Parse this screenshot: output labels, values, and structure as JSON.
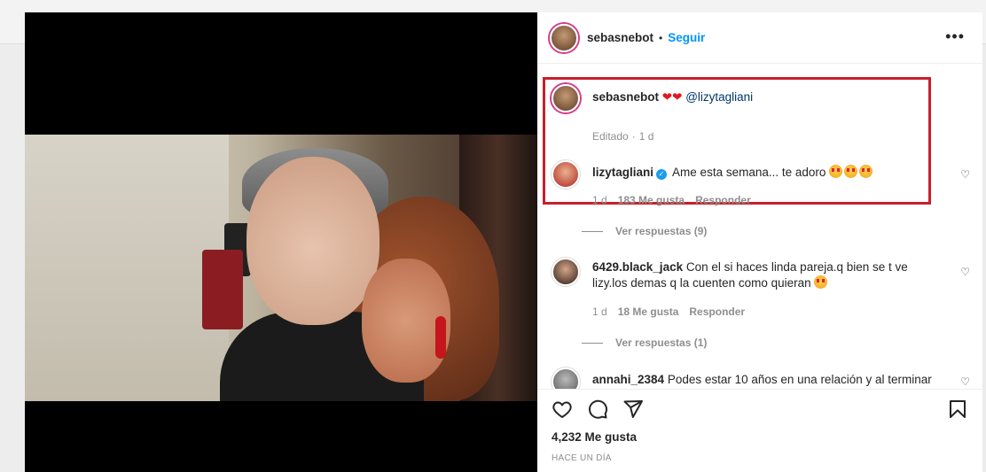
{
  "post": {
    "author": "sebasnebot",
    "dot": "•",
    "follow_label": "Seguir",
    "more_label": "•••",
    "likes": "4,232 Me gusta",
    "time_ago": "HACE UN DÍA"
  },
  "caption": {
    "username": "sebasnebot",
    "hearts": "❤❤",
    "mention": "@lizytagliani",
    "meta_edited": "Editado",
    "meta_dot": "·",
    "meta_time": "1 d"
  },
  "comments": [
    {
      "username": "lizytagliani",
      "verified_icon": "✓",
      "text": "Ame esta semana... te adoro",
      "time": "1 d",
      "likes": "183 Me gusta",
      "reply_label": "Responder",
      "view_replies": "Ver respuestas (9)"
    },
    {
      "username": "6429.black_jack",
      "text": "Con el si haces linda pareja.q bien se t ve lizy.los demas q la cuenten como quieran",
      "time": "1 d",
      "likes": "18 Me gusta",
      "reply_label": "Responder",
      "view_replies": "Ver respuestas (1)"
    },
    {
      "username": "annahi_2384",
      "text": "Podes estar 10 años en una relación y al terminar"
    }
  ],
  "icons": {
    "heart": "heart-icon",
    "comment": "comment-icon",
    "share": "share-icon",
    "bookmark": "bookmark-icon",
    "small_heart": "♡"
  },
  "colors": {
    "accent": "#0095f6",
    "highlight_border": "#c8202b",
    "muted": "#8e8e8e"
  }
}
